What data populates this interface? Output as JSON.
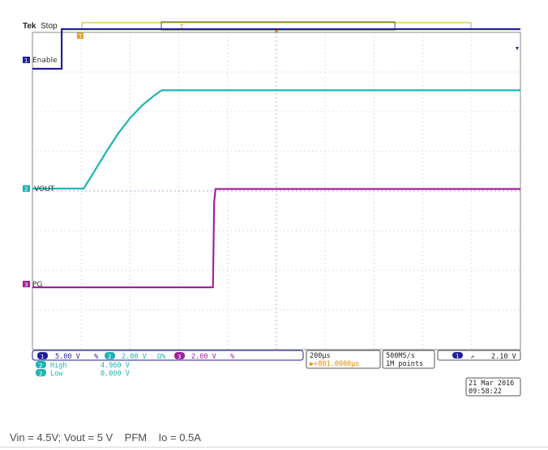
{
  "header": {
    "brand": "Tek",
    "state": "Stop",
    "trigger_marker": "T"
  },
  "traces": {
    "ch1": {
      "label": "Enable",
      "number": "1",
      "color": "#1f1f9c"
    },
    "ch2": {
      "label": "VOUT",
      "number": "2",
      "color": "#1fb3b3"
    },
    "ch3": {
      "label": "PG",
      "number": "3",
      "color": "#a3209e"
    }
  },
  "readout": {
    "ch1_scale": "5.00 V",
    "ch1_coupling": "%",
    "ch2_scale": "2.00 V",
    "ch2_bw": "Ω%",
    "ch3_scale": "2.00 V",
    "ch3_coupling": "%",
    "timebase": "200µs",
    "position": "▶+801.0000µs",
    "sample_rate": "500MS/s",
    "record_length": "1M points",
    "trigger_slope": "↗",
    "trigger_level": "2.10 V",
    "meas_high_label": "High",
    "meas_high_value": "4.960 V",
    "meas_low_label": "Low",
    "meas_low_value": "0.000 V",
    "date": "21 Mar 2016",
    "time": "09:58:22"
  },
  "chart_data": {
    "type": "line",
    "title": "",
    "xlabel": "",
    "ylabel": "",
    "x_unit": "µs",
    "xlim": [
      -1000,
      1000
    ],
    "time_per_div_us": 200,
    "grid": true,
    "series": [
      {
        "name": "Enable",
        "channel": 1,
        "volts_per_div": 5,
        "x": [
          -1000,
          -880,
          -880,
          1000
        ],
        "y": [
          0,
          0,
          5,
          5
        ]
      },
      {
        "name": "VOUT",
        "channel": 2,
        "volts_per_div": 2,
        "x": [
          -1000,
          -790,
          -750,
          -700,
          -650,
          -600,
          -550,
          -500,
          -470,
          -400,
          1000
        ],
        "y": [
          0,
          0,
          0.8,
          1.8,
          2.75,
          3.55,
          4.2,
          4.7,
          4.96,
          4.96,
          4.96
        ]
      },
      {
        "name": "PG",
        "channel": 3,
        "volts_per_div": 2,
        "x": [
          -1000,
          -260,
          -255,
          -250,
          1000
        ],
        "y": [
          0,
          0,
          4.3,
          4.96,
          4.96
        ]
      }
    ]
  },
  "caption": "Vin = 4.5V; Vout = 5 V    PFM    Io = 0.5A"
}
